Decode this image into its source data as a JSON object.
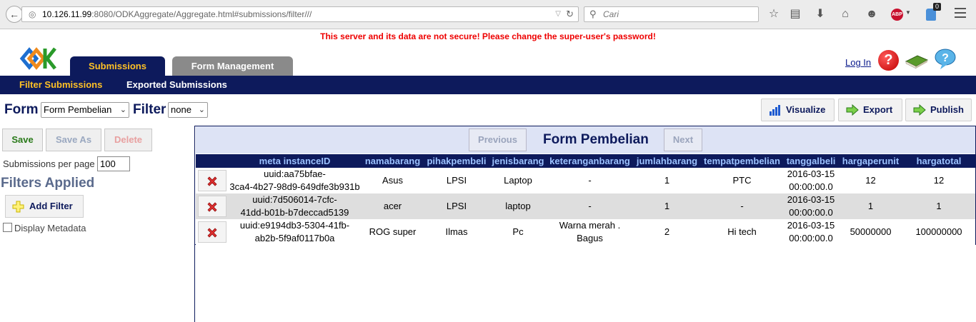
{
  "browser": {
    "url_host": "10.126.11.99",
    "url_rest": ":8080/ODKAggregate/Aggregate.html#submissions/filter///",
    "search_placeholder": "Cari",
    "abp_label": "ABP",
    "notification_count": "0"
  },
  "warning": "This server and its data are not secure! Please change the super-user's password!",
  "header": {
    "tabs": [
      {
        "label": "Submissions",
        "active": true
      },
      {
        "label": "Form Management",
        "active": false
      }
    ],
    "login_label": "Log In",
    "help_icon": "question-mark-icon"
  },
  "subnav": [
    {
      "label": "Filter Submissions",
      "active": true
    },
    {
      "label": "Exported Submissions",
      "active": false
    }
  ],
  "toolbar": {
    "form_label": "Form",
    "form_value": "Form Pembelian",
    "filter_label": "Filter",
    "filter_value": "none",
    "visualize_label": "Visualize",
    "export_label": "Export",
    "publish_label": "Publish"
  },
  "left_pane": {
    "save_label": "Save",
    "save_as_label": "Save As",
    "delete_label": "Delete",
    "per_page_label": "Submissions per page",
    "per_page_value": "100",
    "filters_applied": "Filters Applied",
    "add_filter_label": "Add Filter",
    "display_metadata_label": "Display Metadata"
  },
  "pager": {
    "previous_label": "Previous",
    "title": "Form Pembelian",
    "next_label": "Next"
  },
  "table": {
    "columns": [
      "meta instanceID",
      "namabarang",
      "pihakpembeli",
      "jenisbarang",
      "keteranganbarang",
      "jumlahbarang",
      "tempatpembelian",
      "tanggalbeli",
      "hargaperunit",
      "hargatotal"
    ],
    "rows": [
      {
        "instance_line1": "uuid:aa75bfae-",
        "instance_line2": "3ca4-4b27-98d9-649dfe3b931b",
        "namabarang": "Asus",
        "pihakpembeli": "LPSI",
        "jenisbarang": "Laptop",
        "keterangan_line1": "-",
        "keterangan_line2": "",
        "jumlahbarang": "1",
        "tempatpembelian": "PTC",
        "tanggal_line1": "2016-03-15",
        "tanggal_line2": "00:00:00.0",
        "hargaperunit": "12",
        "hargatotal": "12"
      },
      {
        "instance_line1": "uuid:7d506014-7cfc-",
        "instance_line2": "41dd-b01b-b7deccad5139",
        "namabarang": "acer",
        "pihakpembeli": "LPSI",
        "jenisbarang": "laptop",
        "keterangan_line1": "-",
        "keterangan_line2": "",
        "jumlahbarang": "1",
        "tempatpembelian": "-",
        "tanggal_line1": "2016-03-15",
        "tanggal_line2": "00:00:00.0",
        "hargaperunit": "1",
        "hargatotal": "1"
      },
      {
        "instance_line1": "uuid:e9194db3-5304-41fb-",
        "instance_line2": "ab2b-5f9af0117b0a",
        "namabarang": "ROG super",
        "pihakpembeli": "Ilmas",
        "jenisbarang": "Pc",
        "keterangan_line1": "Warna merah .",
        "keterangan_line2": "Bagus",
        "jumlahbarang": "2",
        "tempatpembelian": "Hi tech",
        "tanggal_line1": "2016-03-15",
        "tanggal_line2": "00:00:00.0",
        "hargaperunit": "50000000",
        "hargatotal": "100000000"
      }
    ]
  }
}
